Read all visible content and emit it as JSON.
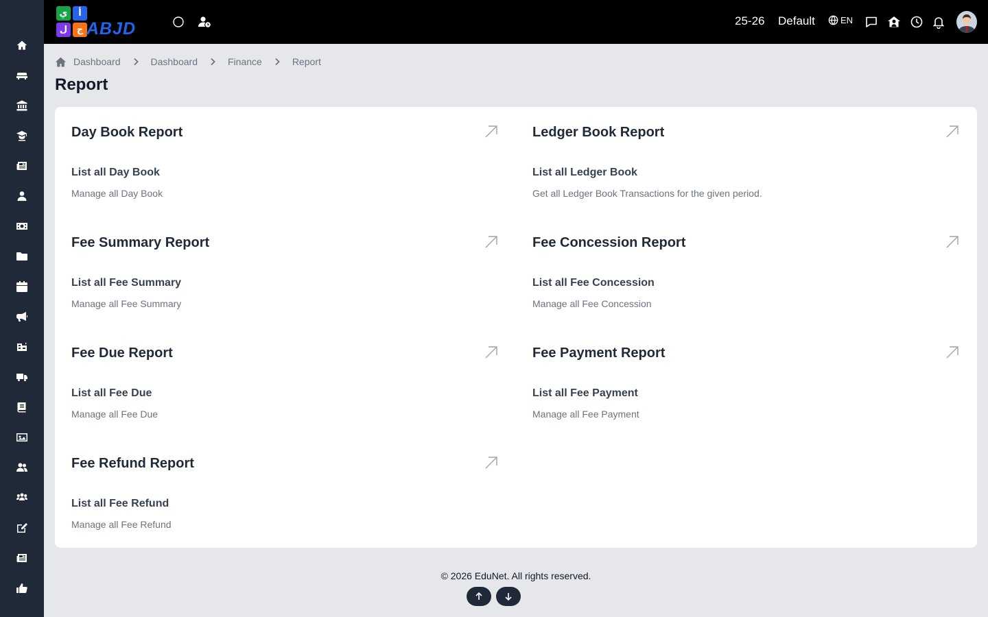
{
  "app": {
    "logo_letters": [
      "ي",
      "أ",
      "ل",
      "ج"
    ],
    "logo_text": "ABJD",
    "session": "25-26",
    "profile": "Default",
    "language": "EN",
    "colors": {
      "sidebar": "#1f2937",
      "topbar": "#000000",
      "accent_blue": "#2563eb",
      "accent_purple": "#7c3aed"
    }
  },
  "sidebar": {
    "items": [
      {
        "icon": "home-icon"
      },
      {
        "icon": "sofa-icon"
      },
      {
        "icon": "institution-icon"
      },
      {
        "icon": "graduate-icon"
      },
      {
        "icon": "news-icon"
      },
      {
        "icon": "user-icon"
      },
      {
        "icon": "money-icon"
      },
      {
        "icon": "folder-icon"
      },
      {
        "icon": "calendar-icon"
      },
      {
        "icon": "megaphone-icon"
      },
      {
        "icon": "school-icon"
      },
      {
        "icon": "truck-icon"
      },
      {
        "icon": "book-icon"
      },
      {
        "icon": "image-icon"
      },
      {
        "icon": "users-icon"
      },
      {
        "icon": "group-icon"
      },
      {
        "icon": "edit-icon"
      },
      {
        "icon": "newspaper-icon"
      },
      {
        "icon": "thumbs-up-icon"
      }
    ]
  },
  "breadcrumb": {
    "items": [
      "Dashboard",
      "Dashboard",
      "Finance",
      "Report"
    ]
  },
  "page": {
    "title": "Report"
  },
  "reports": [
    {
      "title": "Day Book Report",
      "link": "List all Day Book",
      "desc": "Manage all Day Book"
    },
    {
      "title": "Ledger Book Report",
      "link": "List all Ledger Book",
      "desc": "Get all Ledger Book Transactions for the given period."
    },
    {
      "title": "Fee Summary Report",
      "link": "List all Fee Summary",
      "desc": "Manage all Fee Summary"
    },
    {
      "title": "Fee Concession Report",
      "link": "List all Fee Concession",
      "desc": "Manage all Fee Concession"
    },
    {
      "title": "Fee Due Report",
      "link": "List all Fee Due",
      "desc": "Manage all Fee Due"
    },
    {
      "title": "Fee Payment Report",
      "link": "List all Fee Payment",
      "desc": "Manage all Fee Payment"
    },
    {
      "title": "Fee Refund Report",
      "link": "List all Fee Refund",
      "desc": "Manage all Fee Refund"
    }
  ],
  "footer": {
    "text": "© 2026 EduNet. All rights reserved."
  }
}
